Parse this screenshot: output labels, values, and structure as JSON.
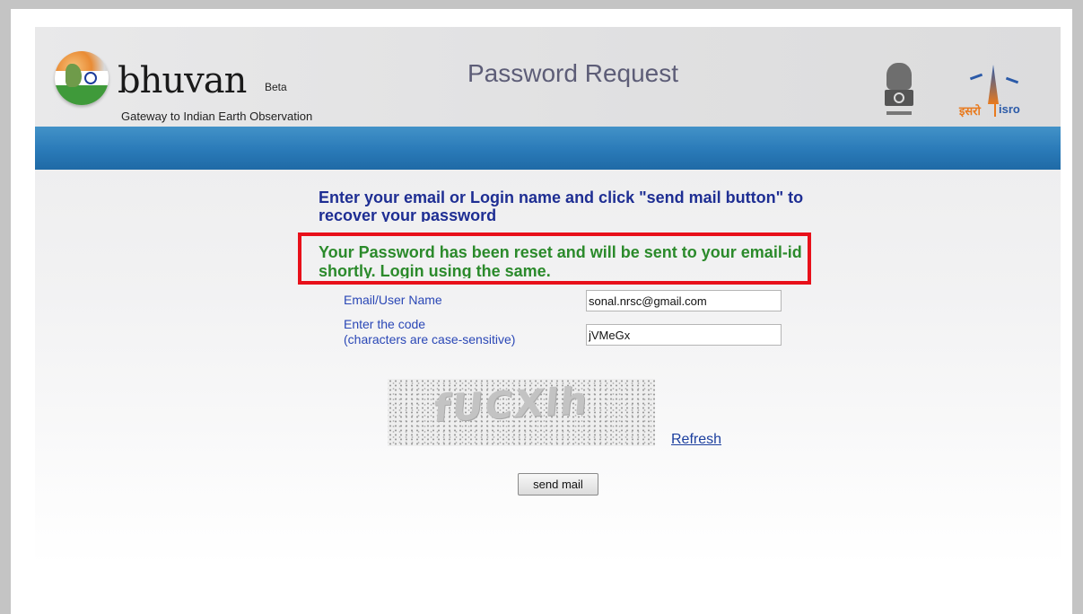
{
  "header": {
    "brand_name": "bhuvan",
    "brand_badge": "Beta",
    "tagline": "Gateway to Indian Earth Observation",
    "page_title": "Password Request",
    "isro_hindi": "इसरो",
    "isro_latin": "isro"
  },
  "messages": {
    "instruction": "Enter your email or Login name and click \"send mail button\" to recover your password",
    "success": "Your Password has been reset and will be sent to your email-id shortly. Login using the same."
  },
  "form": {
    "email_label": "Email/User Name",
    "email_value": "sonal.nrsc@gmail.com",
    "code_label_line1": "Enter the code",
    "code_label_line2": "(characters are case-sensitive)",
    "code_value": "jVMeGx",
    "captcha_text": "fUCXlh",
    "refresh_label": "Refresh",
    "submit_label": "send mail"
  },
  "colors": {
    "header_bar": "#2a7ab8",
    "instruction_text": "#1e2e93",
    "success_text": "#2b8a2b",
    "highlight_border": "#e8101a",
    "label_text": "#2a47b6"
  },
  "icons": [
    "bhuvan-globe-logo-icon",
    "national-emblem-icon",
    "isro-logo-icon"
  ]
}
